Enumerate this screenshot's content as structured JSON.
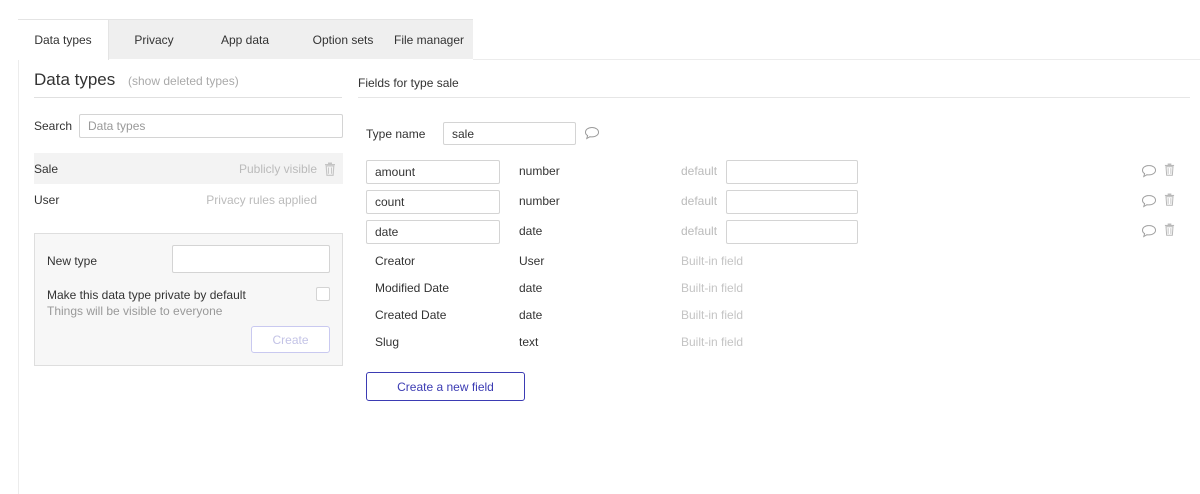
{
  "tabs": [
    {
      "label": "Data types",
      "active": true
    },
    {
      "label": "Privacy"
    },
    {
      "label": "App data"
    },
    {
      "label": "Option sets"
    },
    {
      "label": "File manager"
    }
  ],
  "left": {
    "title": "Data types",
    "show_deleted": "(show deleted types)",
    "search_label": "Search",
    "search_placeholder": "Data types",
    "types": [
      {
        "name": "Sale",
        "privacy": "Publicly visible",
        "selected": true
      },
      {
        "name": "User",
        "privacy": "Privacy rules applied"
      }
    ],
    "new_type": {
      "label": "New type",
      "value": "",
      "private_label": "Make this data type private by default",
      "private_hint": "Things will be visible to everyone",
      "create_label": "Create"
    }
  },
  "right": {
    "title": "Fields for type sale",
    "type_name_label": "Type name",
    "type_name_value": "sale",
    "fields": [
      {
        "name": "amount",
        "type": "number",
        "default_label": "default",
        "default_value": ""
      },
      {
        "name": "count",
        "type": "number",
        "default_label": "default",
        "default_value": ""
      },
      {
        "name": "date",
        "type": "date",
        "default_label": "default",
        "default_value": ""
      }
    ],
    "builtin_fields": [
      {
        "name": "Creator",
        "type": "User",
        "note": "Built-in field"
      },
      {
        "name": "Modified Date",
        "type": "date",
        "note": "Built-in field"
      },
      {
        "name": "Created Date",
        "type": "date",
        "note": "Built-in field"
      },
      {
        "name": "Slug",
        "type": "text",
        "note": "Built-in field"
      }
    ],
    "create_field_label": "Create a new field"
  },
  "colors": {
    "accent": "#3b3bb3",
    "muted": "#bbbbbb",
    "selected_row": "#f3f3f3"
  }
}
